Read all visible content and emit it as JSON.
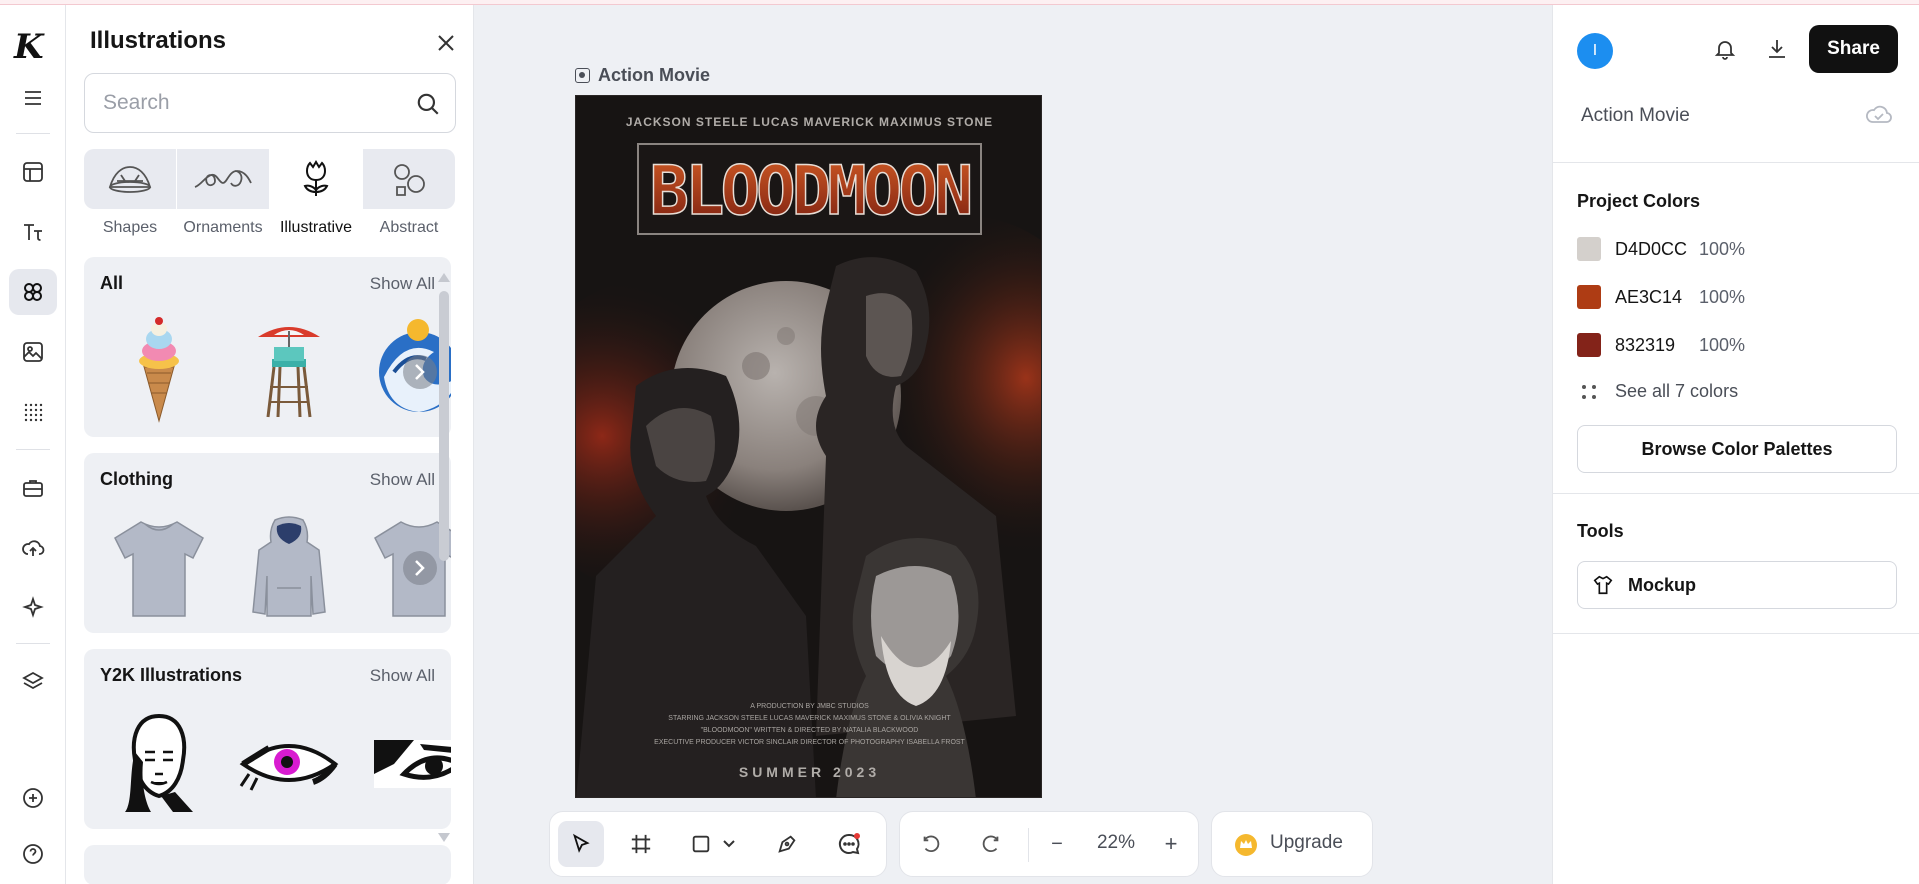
{
  "rail": {
    "logo": "K",
    "items": [
      "menu-icon",
      "templates-icon",
      "text-icon",
      "elements-icon",
      "photos-icon",
      "patterns-icon",
      "brand-icon",
      "uploads-icon",
      "ai-icon",
      "layers-icon",
      "add-icon",
      "help-icon"
    ],
    "active": "elements-icon"
  },
  "panel": {
    "title": "Illustrations",
    "search_placeholder": "Search",
    "categories": [
      {
        "label": "Shapes",
        "icon": "shapes-icon"
      },
      {
        "label": "Ornaments",
        "icon": "ornaments-icon"
      },
      {
        "label": "Illustrative",
        "icon": "tulip-icon"
      },
      {
        "label": "Abstract",
        "icon": "abstract-icon"
      }
    ],
    "active_category": "Illustrative",
    "sections": [
      {
        "title": "All",
        "show_all": "Show All",
        "thumbs": [
          "ice-cream-cone",
          "lifeguard-tower",
          "wave-circle"
        ]
      },
      {
        "title": "Clothing",
        "show_all": "Show All",
        "thumbs": [
          "t-shirt",
          "hoodie",
          "t-shirt"
        ]
      },
      {
        "title": "Y2K Illustrations",
        "show_all": "Show All",
        "thumbs": [
          "face-portrait",
          "pink-eye",
          "eye-closeup"
        ]
      }
    ]
  },
  "canvas": {
    "artboard_label": "Action Movie",
    "poster": {
      "credits_top": "JACKSON STEELE   LUCAS MAVERICK   MAXIMUS STONE",
      "title": "BLOODMOON",
      "credits_bottom": [
        "A PRODUCTION BY JMBC STUDIOS",
        "STARRING JACKSON STEELE LUCAS MAVERICK MAXIMUS STONE & OLIVIA KNIGHT",
        "\"BLOODMOON\" WRITTEN & DIRECTED BY NATALIA BLACKWOOD",
        "EXECUTIVE PRODUCER VICTOR SINCLAIR DIRECTOR OF PHOTOGRAPHY ISABELLA FROST"
      ],
      "release": "SUMMER 2023"
    }
  },
  "toolbar": {
    "tools": [
      "select-icon",
      "frame-icon",
      "rectangle-icon",
      "chevron-down-icon",
      "pen-icon",
      "comment-icon"
    ],
    "zoom": "22%",
    "zoom_out": "−",
    "zoom_in": "+",
    "upgrade_label": "Upgrade"
  },
  "right": {
    "avatar": "I",
    "share_label": "Share",
    "project_name": "Action Movie",
    "colors_title": "Project Colors",
    "colors": [
      {
        "hex": "D4D0CC",
        "pct": "100%",
        "color": "#D4D0CC"
      },
      {
        "hex": "AE3C14",
        "pct": "100%",
        "color": "#AE3C14"
      },
      {
        "hex": "832319",
        "pct": "100%",
        "color": "#832319"
      }
    ],
    "see_all": "See all 7 colors",
    "browse_palettes": "Browse Color Palettes",
    "tools_title": "Tools",
    "mockup_label": "Mockup"
  }
}
